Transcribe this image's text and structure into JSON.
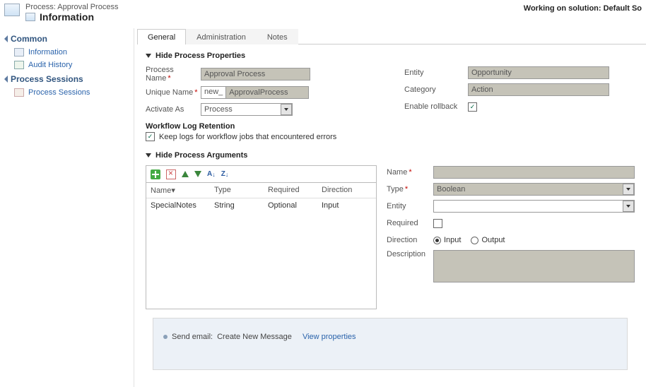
{
  "header": {
    "process_prefix": "Process:",
    "process_name": "Approval Process",
    "title": "Information",
    "working_on": "Working on solution: Default So"
  },
  "sidebar": {
    "section_common": "Common",
    "item_info": "Information",
    "item_audit": "Audit History",
    "section_sessions": "Process Sessions",
    "item_sessions": "Process Sessions"
  },
  "tabs": {
    "general": "General",
    "admin": "Administration",
    "notes": "Notes"
  },
  "properties": {
    "hdr": "Hide Process Properties",
    "process_name_label": "Process Name",
    "process_name_value": "Approval Process",
    "unique_name_label": "Unique Name",
    "unique_prefix": "new_",
    "unique_value": "ApprovalProcess",
    "activate_as_label": "Activate As",
    "activate_as_value": "Process",
    "entity_label": "Entity",
    "entity_value": "Opportunity",
    "category_label": "Category",
    "category_value": "Action",
    "rollback_label": "Enable rollback",
    "log_hdr": "Workflow Log Retention",
    "log_chk_label": "Keep logs for workflow jobs that encountered errors"
  },
  "args": {
    "hdr": "Hide Process Arguments",
    "cols": {
      "name": "Name",
      "type": "Type",
      "required": "Required",
      "direction": "Direction"
    },
    "name_sort_suffix": "▾",
    "rows": [
      {
        "name": "SpecialNotes",
        "type": "String",
        "required": "Optional",
        "direction": "Input"
      }
    ],
    "form": {
      "name_label": "Name",
      "type_label": "Type",
      "type_value": "Boolean",
      "entity_label": "Entity",
      "required_label": "Required",
      "direction_label": "Direction",
      "direction_input": "Input",
      "direction_output": "Output",
      "description_label": "Description"
    }
  },
  "steps": {
    "send_email_label": "Send email:",
    "send_email_value": "Create New Message",
    "view_props": "View properties"
  }
}
